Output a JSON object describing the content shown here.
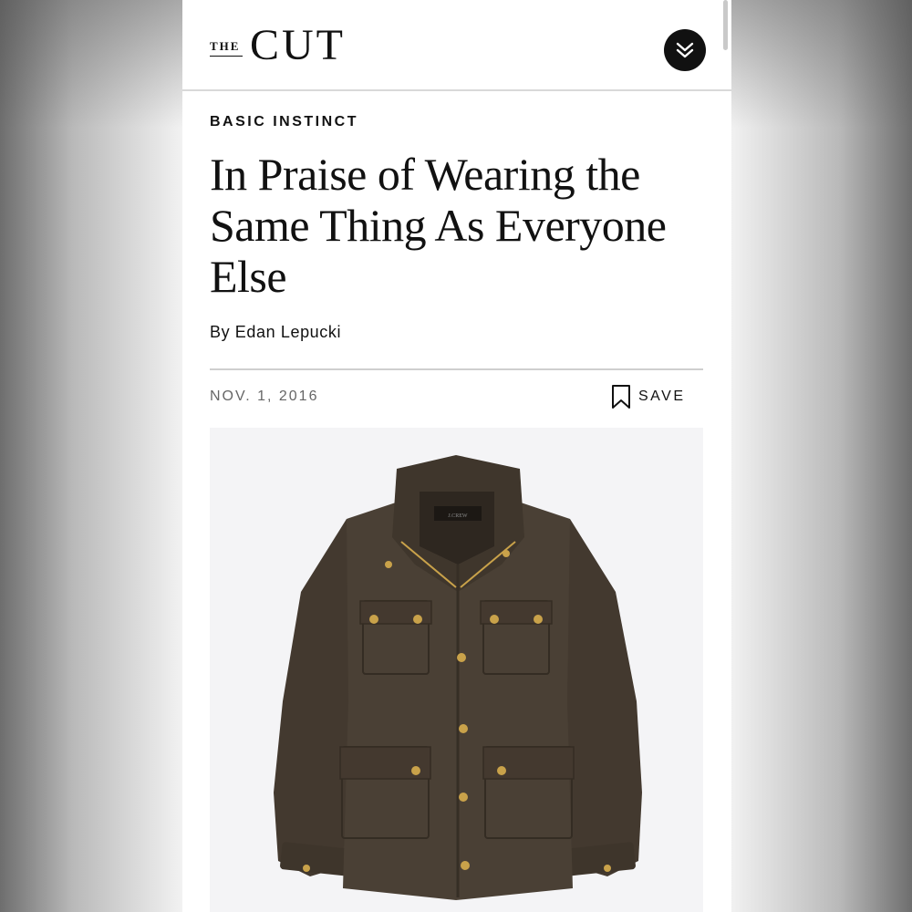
{
  "brand": {
    "the": "THE",
    "name": "CUT"
  },
  "nav": {
    "menu_icon": "double-chevron-down-icon"
  },
  "article": {
    "kicker": "BASIC INSTINCT",
    "headline": "In Praise of Wearing the Same Thing As Everyone Else",
    "byline": "By Edan Lepucki",
    "date": "NOV. 1, 2016",
    "save_label": "SAVE",
    "save_icon": "bookmark-icon",
    "hero_label": "J.CREW"
  },
  "colors": {
    "text": "#111111",
    "meta": "#666666",
    "jacket": "#4a4035",
    "brass": "#c9a24a"
  }
}
